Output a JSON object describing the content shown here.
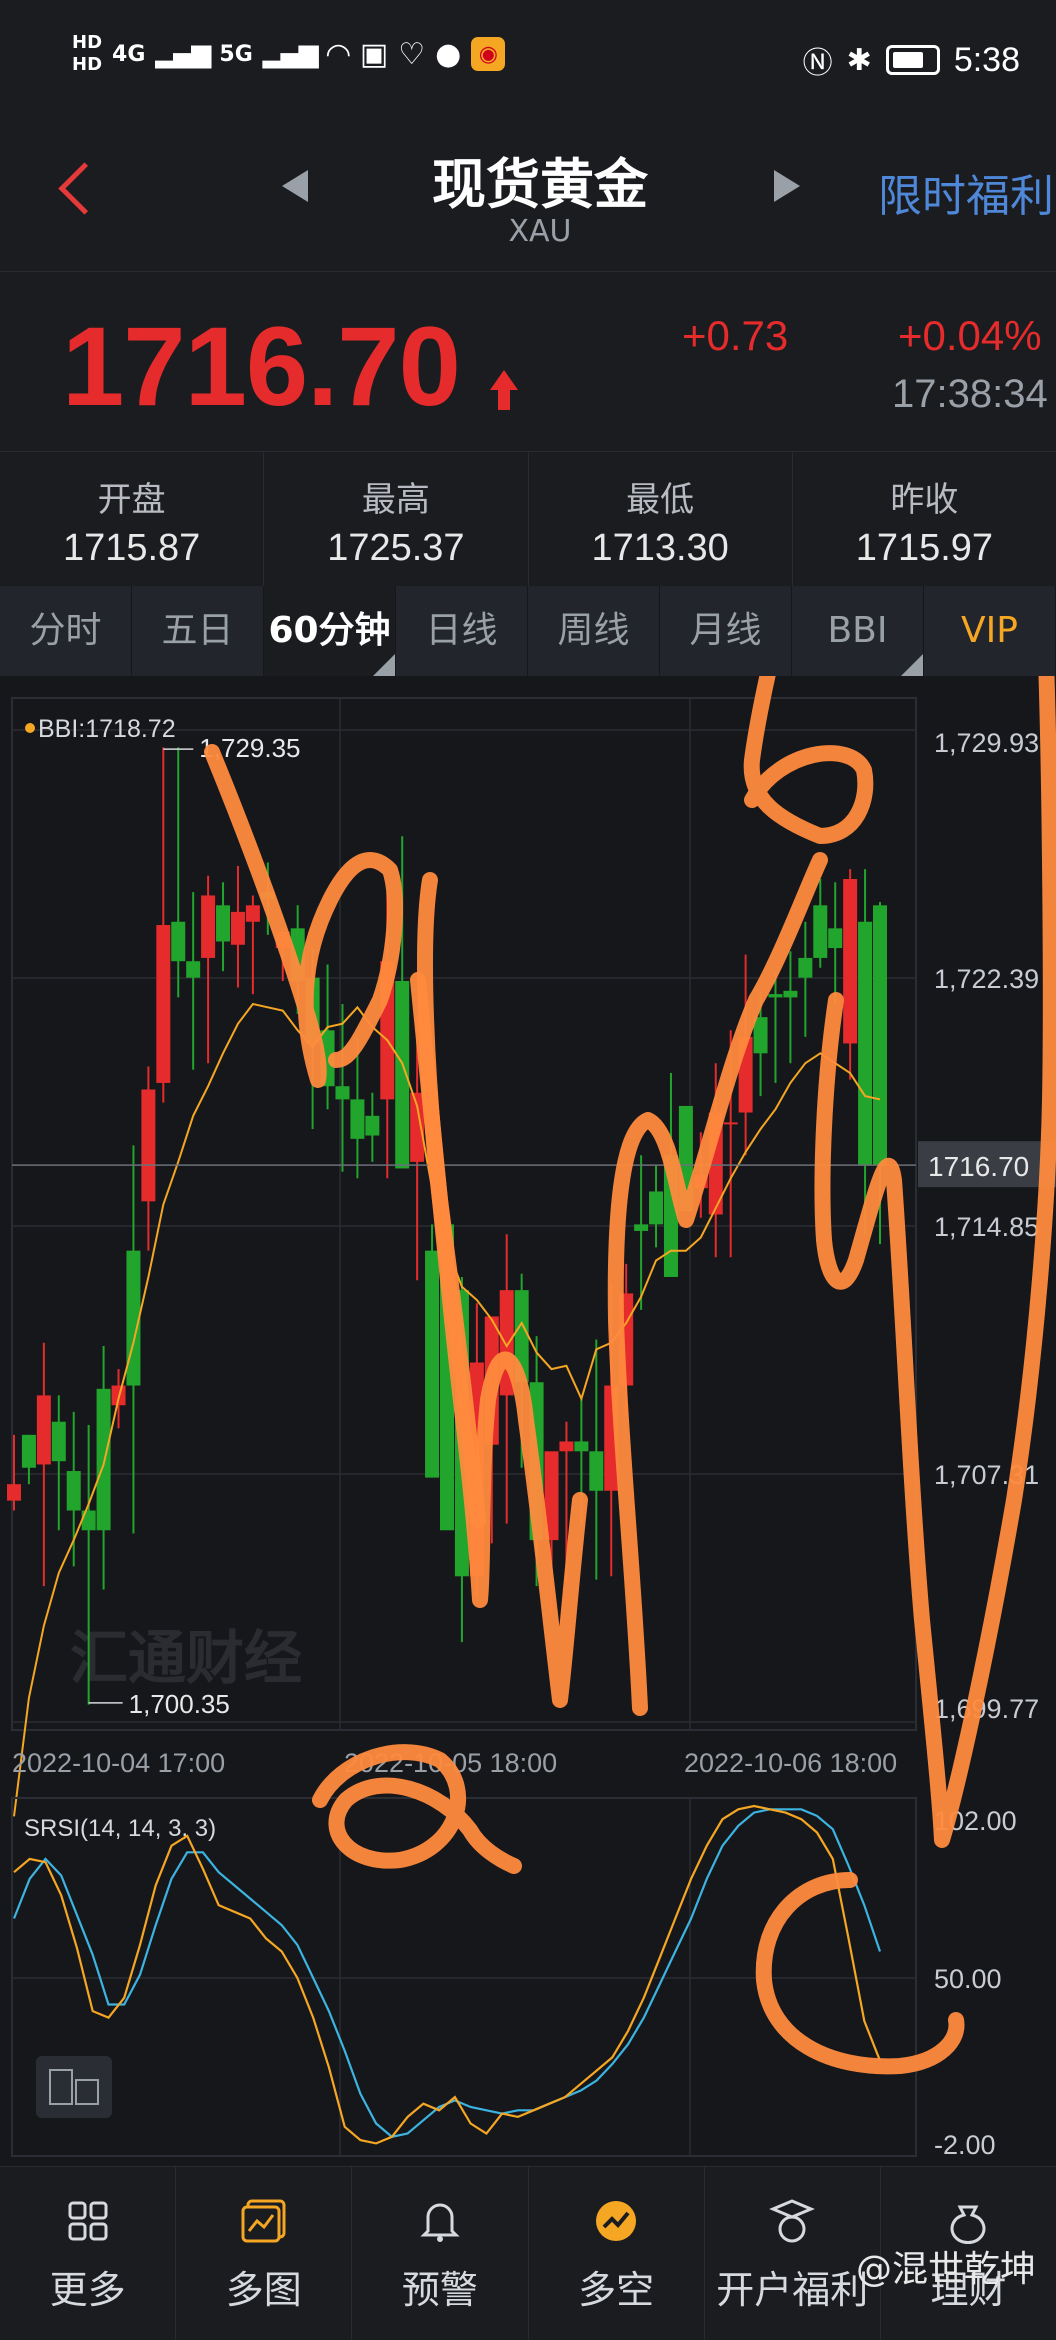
{
  "status_bar": {
    "hd1": "HD",
    "hd2": "HD",
    "net1": "4G",
    "net2": "5G",
    "time": "5:38",
    "icons": [
      "signal-icon",
      "wifi-icon",
      "tv-icon",
      "heart-icon",
      "message-icon",
      "weibo-icon",
      "nfc-icon",
      "bluetooth-icon",
      "battery-icon"
    ]
  },
  "header": {
    "title": "现货黄金",
    "subtitle": "XAU",
    "promo": "限时福利"
  },
  "quote": {
    "price": "1716.70",
    "change": "+0.73",
    "change_pct": "+0.04%",
    "time": "17:38:34"
  },
  "stats": [
    {
      "label": "开盘",
      "value": "1715.87"
    },
    {
      "label": "最高",
      "value": "1725.37"
    },
    {
      "label": "最低",
      "value": "1713.30"
    },
    {
      "label": "昨收",
      "value": "1715.97"
    }
  ],
  "tabs": [
    {
      "label": "分时",
      "active": false
    },
    {
      "label": "五日",
      "active": false
    },
    {
      "label": "60分钟",
      "active": true
    },
    {
      "label": "日线",
      "active": false
    },
    {
      "label": "周线",
      "active": false
    },
    {
      "label": "月线",
      "active": false
    },
    {
      "label": "BBI",
      "active": false
    },
    {
      "label": "VIP",
      "active": false
    }
  ],
  "colors": {
    "up": "#e52b2b",
    "down": "#22a52c",
    "bbi": "#f5a623",
    "srsi_k": "#f5a623",
    "srsi_d": "#3cb3e0",
    "annotation": "#ff8a3d",
    "grid": "#2a2d33"
  },
  "chart_data": [
    {
      "type": "candlestick",
      "indicator_label": "BBI:1718.72",
      "y_ticks": [
        "1,729.93",
        "1,722.39",
        "1,714.85",
        "1,707.31",
        "1,699.77"
      ],
      "current_price_label": "1716.70",
      "high_marker": "1,729.35",
      "low_marker": "1,700.35",
      "x_ticks": [
        "2022-10-04 17:00",
        "2022-10-05 18:00",
        "2022-10-06 18:00"
      ],
      "ylim": [
        1699.77,
        1729.93
      ],
      "candles": [
        [
          1706.5,
          1708.5,
          1706.2,
          1707.0
        ],
        [
          1708.5,
          1708.5,
          1707.0,
          1707.5
        ],
        [
          1707.6,
          1711.3,
          1703.9,
          1709.7
        ],
        [
          1708.9,
          1709.7,
          1705.6,
          1707.7
        ],
        [
          1707.4,
          1709.2,
          1704.5,
          1706.2
        ],
        [
          1706.2,
          1708.8,
          1700.3,
          1705.6
        ],
        [
          1709.9,
          1711.2,
          1703.8,
          1705.6
        ],
        [
          1709.4,
          1710.5,
          1708.7,
          1710.0
        ],
        [
          1714.1,
          1717.3,
          1705.5,
          1710.0
        ],
        [
          1715.6,
          1719.7,
          1714.1,
          1719.0
        ],
        [
          1719.2,
          1729.4,
          1718.6,
          1724.0
        ],
        [
          1724.1,
          1729.4,
          1721.8,
          1722.9
        ],
        [
          1722.9,
          1725.0,
          1719.6,
          1722.4
        ],
        [
          1723.0,
          1725.5,
          1719.8,
          1724.9
        ],
        [
          1724.6,
          1725.3,
          1722.6,
          1723.5
        ],
        [
          1723.4,
          1725.8,
          1722.1,
          1724.4
        ],
        [
          1724.1,
          1724.9,
          1721.9,
          1724.6
        ],
        [
          1725.0,
          1725.9,
          1723.7,
          1724.8
        ],
        [
          1723.3,
          1723.8,
          1722.3,
          1723.8
        ],
        [
          1723.9,
          1724.6,
          1721.3,
          1722.3
        ],
        [
          1722.4,
          1723.3,
          1717.8,
          1720.4
        ],
        [
          1720.8,
          1722.8,
          1718.4,
          1719.1
        ],
        [
          1719.1,
          1721.6,
          1716.5,
          1718.7
        ],
        [
          1718.7,
          1720.6,
          1716.3,
          1717.5
        ],
        [
          1718.2,
          1718.9,
          1716.8,
          1717.6
        ],
        [
          1718.7,
          1725.0,
          1716.3,
          1722.9
        ],
        [
          1722.3,
          1726.7,
          1717.4,
          1716.6
        ],
        [
          1716.8,
          1721.2,
          1713.2,
          1718.9
        ],
        [
          1714.1,
          1714.9,
          1709.0,
          1707.2
        ],
        [
          1714.9,
          1714.8,
          1705.9,
          1705.6
        ],
        [
          1712.9,
          1713.3,
          1702.2,
          1704.2
        ],
        [
          1704.2,
          1712.5,
          1703.6,
          1710.7
        ],
        [
          1708.2,
          1709.7,
          1705.2,
          1712.1
        ],
        [
          1709.7,
          1714.6,
          1705.8,
          1712.9
        ],
        [
          1712.9,
          1713.4,
          1707.5,
          1710.1
        ],
        [
          1710.1,
          1711.5,
          1703.9,
          1705.3
        ],
        [
          1705.3,
          1706.9,
          1703.1,
          1708.0
        ],
        [
          1708.0,
          1708.9,
          1704.0,
          1708.3
        ],
        [
          1708.3,
          1709.6,
          1705.8,
          1708.0
        ],
        [
          1708.0,
          1711.4,
          1704.1,
          1706.8
        ],
        [
          1706.8,
          1713.1,
          1704.2,
          1710.0
        ],
        [
          1710.0,
          1713.7,
          1709.1,
          1712.8
        ],
        [
          1714.9,
          1717.0,
          1712.3,
          1714.7
        ],
        [
          1715.9,
          1716.7,
          1714.2,
          1714.9
        ],
        [
          1717.0,
          1719.5,
          1713.3,
          1713.3
        ],
        [
          1718.5,
          1717.9,
          1715.7,
          1715.3
        ],
        [
          1716.0,
          1717.7,
          1715.1,
          1716.4
        ],
        [
          1715.2,
          1719.8,
          1713.9,
          1718.3
        ],
        [
          1718.0,
          1720.8,
          1713.9,
          1718.0
        ],
        [
          1718.3,
          1723.1,
          1717.0,
          1720.6
        ],
        [
          1721.2,
          1722.0,
          1718.8,
          1720.1
        ],
        [
          1721.9,
          1722.6,
          1719.2,
          1721.8
        ],
        [
          1722.0,
          1723.2,
          1719.8,
          1721.8
        ],
        [
          1723.0,
          1724.1,
          1720.6,
          1722.4
        ],
        [
          1724.6,
          1725.4,
          1722.7,
          1723.0
        ],
        [
          1723.9,
          1725.3,
          1721.6,
          1723.3
        ],
        [
          1720.4,
          1725.7,
          1719.3,
          1725.4
        ],
        [
          1724.1,
          1725.7,
          1714.6,
          1716.7
        ],
        [
          1724.6,
          1724.7,
          1714.3,
          1716.7
        ]
      ],
      "bbi": [
        1696.9,
        1700.5,
        1702.7,
        1704.3,
        1705.3,
        1706.4,
        1707.6,
        1709.6,
        1711.3,
        1713.3,
        1715.5,
        1716.8,
        1718.2,
        1719.1,
        1720.1,
        1721.0,
        1721.6,
        1721.5,
        1721.4,
        1720.8,
        1720.3,
        1720.9,
        1721.0,
        1721.5,
        1720.9,
        1720.5,
        1719.8,
        1718.5,
        1716.0,
        1714.2,
        1713.0,
        1712.6,
        1712.0,
        1711.2,
        1711.9,
        1711.0,
        1710.5,
        1710.6,
        1709.6,
        1711.1,
        1711.3,
        1711.9,
        1712.7,
        1713.8,
        1714.1,
        1714.1,
        1714.5,
        1715.4,
        1716.3,
        1717.1,
        1717.8,
        1718.4,
        1719.2,
        1719.8,
        1720.1,
        1719.8,
        1719.5,
        1718.8,
        1718.7
      ]
    },
    {
      "type": "line",
      "indicator_label": "SRSI(14, 14, 3, 3)",
      "y_ticks": [
        "102.00",
        "50.00",
        "-2.00"
      ],
      "ylim": [
        -2,
        102
      ],
      "series": [
        {
          "values": [
            82,
            86,
            85,
            75,
            59,
            40,
            38,
            44,
            60,
            78,
            90,
            93,
            83,
            72,
            70,
            68,
            62,
            58,
            50,
            38,
            23,
            5,
            1,
            0,
            2,
            8,
            12,
            10,
            14,
            6,
            3,
            9,
            8,
            10,
            12,
            14,
            18,
            22,
            26,
            34,
            44,
            56,
            68,
            80,
            90,
            98,
            101,
            102,
            101,
            100,
            98,
            94,
            86,
            62,
            37,
            25
          ]
        },
        {
          "values": [
            68,
            80,
            86,
            81,
            69,
            57,
            42,
            42,
            51,
            66,
            80,
            88,
            88,
            82,
            78,
            74,
            70,
            66,
            60,
            50,
            40,
            28,
            15,
            6,
            2,
            3,
            7,
            11,
            13,
            11,
            10,
            9,
            10,
            10,
            12,
            14,
            16,
            19,
            24,
            30,
            38,
            48,
            58,
            68,
            80,
            90,
            96,
            100,
            101,
            101,
            101,
            99,
            95,
            84,
            72,
            58
          ]
        }
      ]
    }
  ],
  "annotations": [
    "a",
    "b",
    "c"
  ],
  "bottom_nav": [
    {
      "label": "更多",
      "icon": "grid-icon"
    },
    {
      "label": "多图",
      "icon": "multi-chart-icon"
    },
    {
      "label": "预警",
      "icon": "bell-icon"
    },
    {
      "label": "多空",
      "icon": "trend-icon"
    },
    {
      "label": "开户福利",
      "icon": "gift-icon"
    },
    {
      "label": "理财",
      "icon": "money-bag-icon"
    }
  ],
  "watermark_text": "汇通财经",
  "credit_text": "@混世乾坤"
}
